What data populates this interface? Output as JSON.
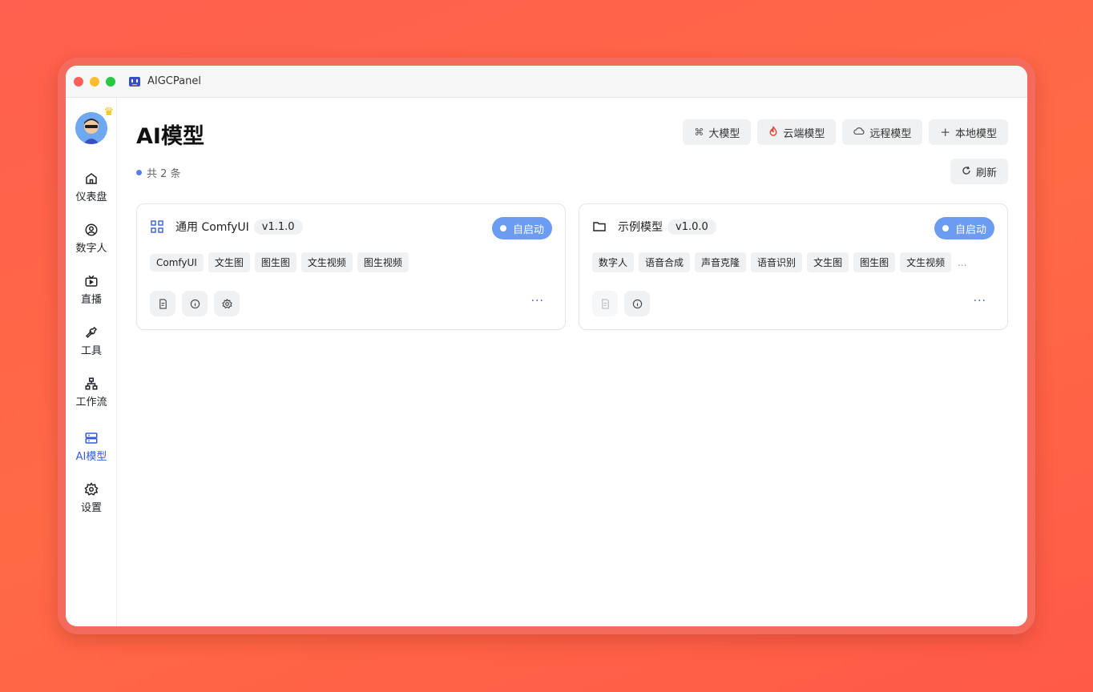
{
  "window": {
    "title": "AIGCPanel"
  },
  "sidebar": {
    "items": [
      {
        "label": "仪表盘",
        "icon": "home-icon"
      },
      {
        "label": "数字人",
        "icon": "user-circle-icon"
      },
      {
        "label": "直播",
        "icon": "tv-icon"
      },
      {
        "label": "工具",
        "icon": "wrench-icon"
      },
      {
        "label": "工作流",
        "icon": "workflow-icon"
      },
      {
        "label": "AI模型",
        "icon": "server-icon",
        "active": true
      },
      {
        "label": "设置",
        "icon": "gear-icon"
      }
    ]
  },
  "header": {
    "title": "AI模型",
    "buttons": [
      {
        "label": "大模型",
        "icon": "command-icon"
      },
      {
        "label": "云端模型",
        "icon": "fire-icon"
      },
      {
        "label": "远程模型",
        "icon": "cloud-icon"
      },
      {
        "label": "本地模型",
        "icon": "plus-icon"
      }
    ],
    "count": "共 2 条",
    "refresh_label": "刷新"
  },
  "models": [
    {
      "name": "通用 ComfyUI",
      "version": "v1.1.0",
      "status": "自启动",
      "tags": [
        "ComfyUI",
        "文生图",
        "图生图",
        "文生视频",
        "图生视频"
      ]
    },
    {
      "name": "示例模型",
      "version": "v1.0.0",
      "status": "自启动",
      "tags": [
        "数字人",
        "语音合成",
        "声音克隆",
        "语音识别",
        "文生图",
        "图生图",
        "文生视频"
      ],
      "more_tags": "..."
    }
  ],
  "colors": {
    "accent": "#3a5bd9",
    "status": "#6c9cf2",
    "background": "#ff5f4e"
  }
}
